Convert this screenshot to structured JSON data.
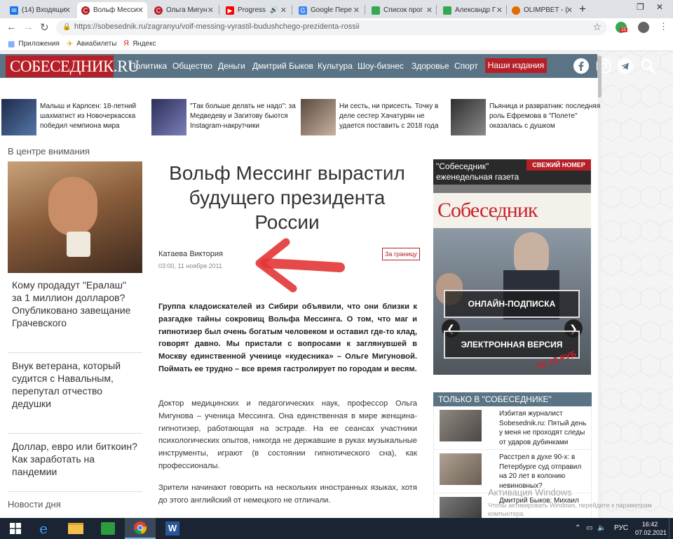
{
  "browser": {
    "tabs": [
      {
        "title": "(14) Входящи",
        "icon": "mail-icon",
        "color": "#1a73e8"
      },
      {
        "title": "Вольф Месси",
        "icon": "site-icon",
        "color": "#b61f27"
      },
      {
        "title": "Ольга Мигун",
        "icon": "site-icon",
        "color": "#b61f27"
      },
      {
        "title": "Progress",
        "icon": "youtube-icon",
        "color": "#ff0000"
      },
      {
        "title": "Google Пере",
        "icon": "google-icon",
        "color": "#4285f4"
      },
      {
        "title": "Список прог",
        "icon": "sheet-icon",
        "color": "#34a853"
      },
      {
        "title": "Александр Г",
        "icon": "sheet-icon",
        "color": "#34a853"
      },
      {
        "title": "OLIMPBET - (",
        "icon": "olimp-icon",
        "color": "#e36b00"
      }
    ],
    "url": "https://sobesednik.ru/zagranyu/volf-messing-vyrastil-budushchego-prezidenta-rossii",
    "ext_badge": "11",
    "bookmarks": [
      {
        "label": "Приложения",
        "icon": "apps-icon"
      },
      {
        "label": "Авиабилеты",
        "icon": "plane-icon"
      },
      {
        "label": "Яндекс",
        "icon": "yandex-icon"
      }
    ]
  },
  "site": {
    "logo": "СОБЕСЕДНИК.RU",
    "nav": [
      "Политика",
      "Общество",
      "Деньги",
      "Дмитрий Быков",
      "Культура",
      "Шоу-бизнес",
      "Здоровье",
      "Спорт"
    ],
    "nav_button": "Наши издания",
    "social_icons": [
      "facebook-icon",
      "instagram-icon",
      "telegram-icon",
      "search-icon"
    ]
  },
  "teasers": [
    {
      "title": "Малыш и Карлсен: 18-летний шахматист из Новочеркасска победил чемпиона мира",
      "thumb": "#2b3a5a"
    },
    {
      "title": "\"Так больше делать не надо\": за Медведеву и Загитову бьются Instagram-накрутчики",
      "thumb": "#3b3f6e"
    },
    {
      "title": "Ни сесть, ни присесть. Точку в деле сестер Хачатурян не удается поставить с 2018 года",
      "thumb": "#7a6a60"
    },
    {
      "title": "Пьяница и развратник: последняя роль Ефремова в \"Полете\" оказалась с душком",
      "thumb": "#4b4b4b"
    }
  ],
  "sidebar": {
    "heading": "В центре внимания",
    "cards": [
      "Кому продадут \"Ералаш\" за 1 миллион долларов? Опубликовано завещание Грачевского",
      "Внук ветерана, который судится с Навальным, перепутал отчество дедушки",
      "Доллар, евро или биткоин? Как заработать на пандемии"
    ],
    "news_heading": "Новости дня"
  },
  "article": {
    "title": "Вольф Мессинг вырастил будущего президента России",
    "author": "Катаева Виктория",
    "date": "03:00, 11 ноября 2011",
    "rubric": "За границу",
    "lead": "Группа кладоискателей из Сибири объявили, что они близки к разгадке тайны сокровищ Вольфа Мессинга. О том, что маг и гипнотизер был очень богатым человеком и оставил где-то клад, говорят давно. Мы пристали с вопросами к заглянувшей в Москву единственной ученице «кудесника» – Ольге Мигуновой. Поймать ее трудно – все время гастролирует по городам и весям.",
    "p1": "Доктор медицинских и педагогических наук, профессор Ольга Мигунова – ученица Мессинга. Она единственная в мире женщина-гипнотизер, работающая на эстраде. На ее сеансах участники психологических опытов, никогда не державшие в руках музыкальные инструменты, играют (в состоянии гипнотического сна), как профессионалы.",
    "p2": "Зрители начинают говорить на нескольких иностранных языках, хотя до этого английский от немецкого не отличали."
  },
  "promo": {
    "title_line1": "\"Собеседник\"",
    "title_line2": "еженедельная газета",
    "fresh": "СВЕЖИЙ НОМЕР",
    "masthead": "Собеседник",
    "btn_subscribe": "ОНЛАЙН-ПОДПИСКА",
    "btn_digital": "ЭЛЕКТРОННАЯ ВЕРСИЯ",
    "price": "ЗА 10 РУБ"
  },
  "only": {
    "heading": "ТОЛЬКО В \"СОБЕСЕДНИКЕ\"",
    "items": [
      {
        "title": "Избитая журналист Sobesednik.ru: Пятый день у меня не проходят следы от ударов дубинками",
        "thumb": "#6e6a66"
      },
      {
        "title": "Расстрел в духе 90-х: в Петербурге суд отправил на 20 лет в колонию невиновных?",
        "thumb": "#8a7f74"
      },
      {
        "title": "Дмитрий Быков: Михаил",
        "thumb": "#5a5a5a"
      }
    ]
  },
  "watermark": {
    "line1": "Активация Windows",
    "line2": "Чтобы активировать Windows, перейдите к параметрам компьютера."
  },
  "taskbar": {
    "lang": "РУС",
    "time": "16:42",
    "date": "07.02.2021"
  }
}
